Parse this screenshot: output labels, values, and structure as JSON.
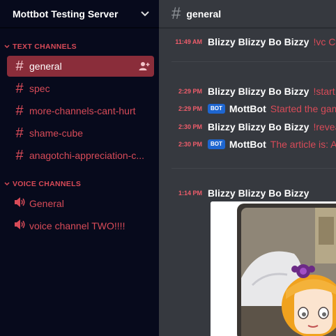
{
  "server": {
    "name": "Mottbot Testing Server"
  },
  "sidebar": {
    "text_category": "TEXT CHANNELS",
    "voice_category": "VOICE CHANNELS",
    "text_channels": [
      {
        "label": "general"
      },
      {
        "label": "spec"
      },
      {
        "label": "more-channels-cant-hurt"
      },
      {
        "label": "shame-cube"
      },
      {
        "label": "anagotchi-appreciation-c..."
      }
    ],
    "voice_channels": [
      {
        "label": "General"
      },
      {
        "label": "voice channel TWO!!!!"
      }
    ]
  },
  "channel": {
    "name": "general"
  },
  "messages": [
    {
      "time": "11:49 AM",
      "author": "Blizzy Blizzy Bo Bizzy",
      "text": "!vc Chess"
    },
    {
      "time": "2:29 PM",
      "author": "Blizzy Blizzy Bo Bizzy",
      "text": "!start trivia"
    },
    {
      "time": "2:29 PM",
      "author": "MottBot",
      "bot_tag": "BOT",
      "text": "Started the game"
    },
    {
      "time": "2:30 PM",
      "author": "Blizzy Blizzy Bo Bizzy",
      "text": "!reveal"
    },
    {
      "time": "2:30 PM",
      "author": "MottBot",
      "bot_tag": "BOT",
      "text": "The article is: A"
    },
    {
      "time": "1:14 PM",
      "author": "Blizzy Blizzy Bo Bizzy",
      "text": ""
    }
  ],
  "colors": {
    "accent": "#d84b58",
    "active_channel_bg": "#8a2d3a",
    "sidebar_bg": "#070a1c",
    "chat_bg": "#36393f",
    "bot_badge": "#1e66d0"
  }
}
